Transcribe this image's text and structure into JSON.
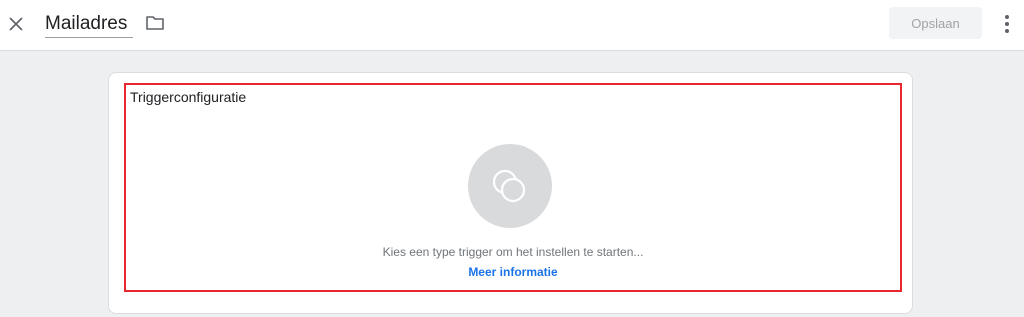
{
  "header": {
    "close_icon": "close-icon",
    "title": "Mailadres",
    "folder_icon": "folder-icon",
    "save_label": "Opslaan",
    "more_icon": "more-vert-icon"
  },
  "trigger_config": {
    "title": "Triggerconfiguratie",
    "trigger_icon": "trigger-type-icon",
    "hint": "Kies een type trigger om het instellen te starten...",
    "learn_more": "Meer informatie"
  },
  "colors": {
    "highlight_border": "#e8262e",
    "link": "#1a73e8",
    "page_background": "#eeeff1"
  }
}
